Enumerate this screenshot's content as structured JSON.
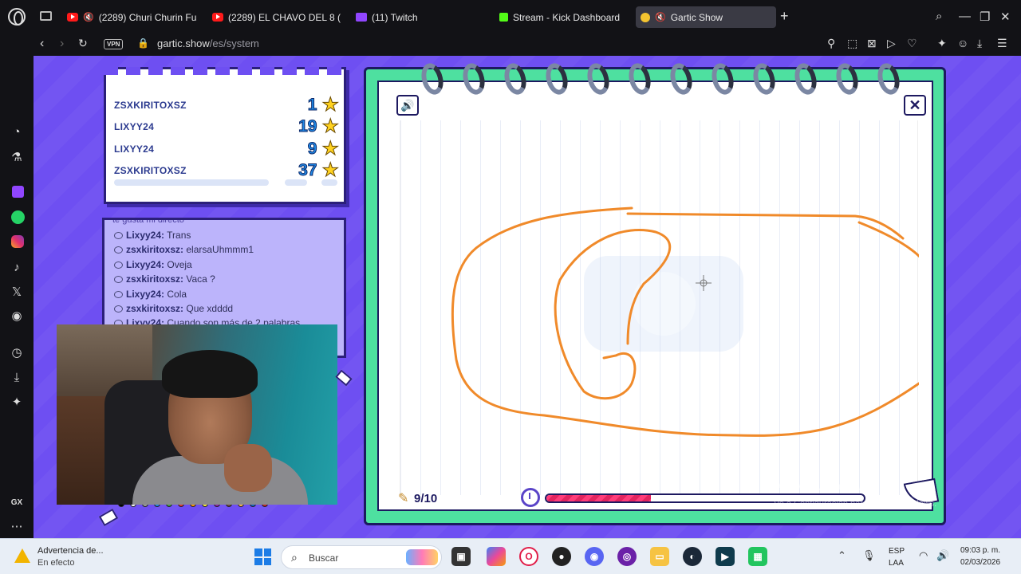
{
  "browser": {
    "tabs": [
      {
        "label": "(2289) Churi Churin Fu",
        "icon": "youtube-icon",
        "muted": true
      },
      {
        "label": "(2289) EL CHAVO DEL 8 (",
        "icon": "youtube-icon",
        "muted": false
      },
      {
        "label": "(11) Twitch",
        "icon": "twitch-icon",
        "muted": false
      },
      {
        "label": "Stream - Kick Dashboard",
        "icon": "kick-icon",
        "muted": false
      },
      {
        "label": "Gartic Show",
        "icon": "gartic-icon",
        "muted": true,
        "active": true
      }
    ],
    "vpn_label": "VPN",
    "url_host": "gartic.show",
    "url_path": "/es/system"
  },
  "scoreboard": {
    "players": [
      {
        "name": "ZSXKIRITOXSZ",
        "points": "1"
      },
      {
        "name": "LIXYY24",
        "points": "19"
      },
      {
        "name": "LIXYY24",
        "points": "9"
      },
      {
        "name": "ZSXKIRITOXSZ",
        "points": "37"
      }
    ]
  },
  "chat": {
    "partial_top": "te gusta mi directo",
    "messages": [
      {
        "user": "Lixyy24:",
        "text": "Trans"
      },
      {
        "user": "zsxkiritoxsz:",
        "text": "elarsaUhmmm1"
      },
      {
        "user": "Lixyy24:",
        "text": "Oveja"
      },
      {
        "user": "zsxkiritoxsz:",
        "text": "Vaca ?"
      },
      {
        "user": "Lixyy24:",
        "text": "Cola"
      },
      {
        "user": "zsxkiritoxsz:",
        "text": "Que xdddd"
      },
      {
        "user": "Lixyy24:",
        "text": "Cuando son más de 2 palabras"
      }
    ]
  },
  "game": {
    "round": "9/10",
    "timer_progress": 0.33,
    "brush_color": "#f08a2a",
    "palette": [
      "#000000",
      "#ffffff",
      "#9e9e9e",
      "#1e88e5",
      "#43a047",
      "#e53935",
      "#ff9800",
      "#ffeb3b",
      "#8e24aa",
      "#6d4c41",
      "#ffb74d",
      "#1565c0",
      "#c62828"
    ]
  },
  "watermark": {
    "title": "Activar Windows",
    "subtitle": "Ve a Configuración para activar Windows."
  },
  "taskbar": {
    "notification_title": "Advertencia de...",
    "notification_sub": "En efecto",
    "search_placeholder": "Buscar",
    "lang_top": "ESP",
    "lang_bottom": "LAA",
    "time": "09:03 p. m.",
    "date": "02/03/2026"
  }
}
